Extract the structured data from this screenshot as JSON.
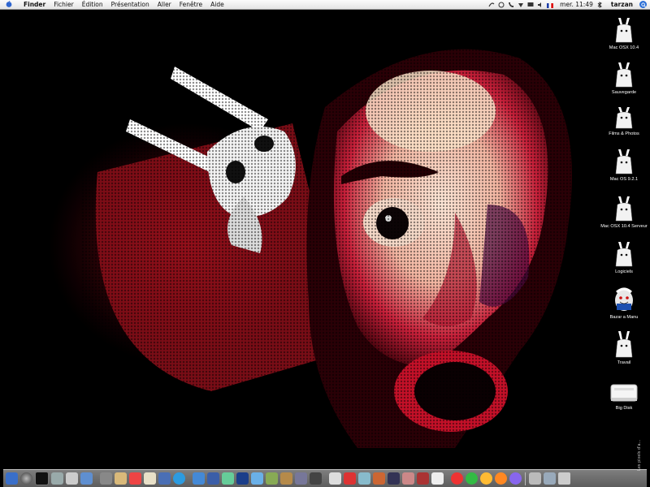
{
  "menubar": {
    "app": "Finder",
    "items": [
      "Fichier",
      "Édition",
      "Présentation",
      "Aller",
      "Fenêtre",
      "Aide"
    ],
    "clock": "mer. 11:49",
    "user": "tarzan"
  },
  "desktop_icons": [
    {
      "label": "Mac OSX 10.4"
    },
    {
      "label": "Sauvegarde"
    },
    {
      "label": "Films & Photos"
    },
    {
      "label": "Mac OS 9.2.1"
    },
    {
      "label": "Mac OSX 10.4 Serveur"
    },
    {
      "label": "Logiciels"
    },
    {
      "label": "Bazar a Manu"
    },
    {
      "label": "Travail"
    },
    {
      "label": "Big Disk"
    }
  ],
  "dock": {
    "side_text": "Les pixels d'a..."
  },
  "colors": {
    "menubar": "#ececec",
    "desktop": "#000000",
    "wallpaper_red": "#a8101c",
    "wallpaper_skin": "#f0c8b0"
  }
}
